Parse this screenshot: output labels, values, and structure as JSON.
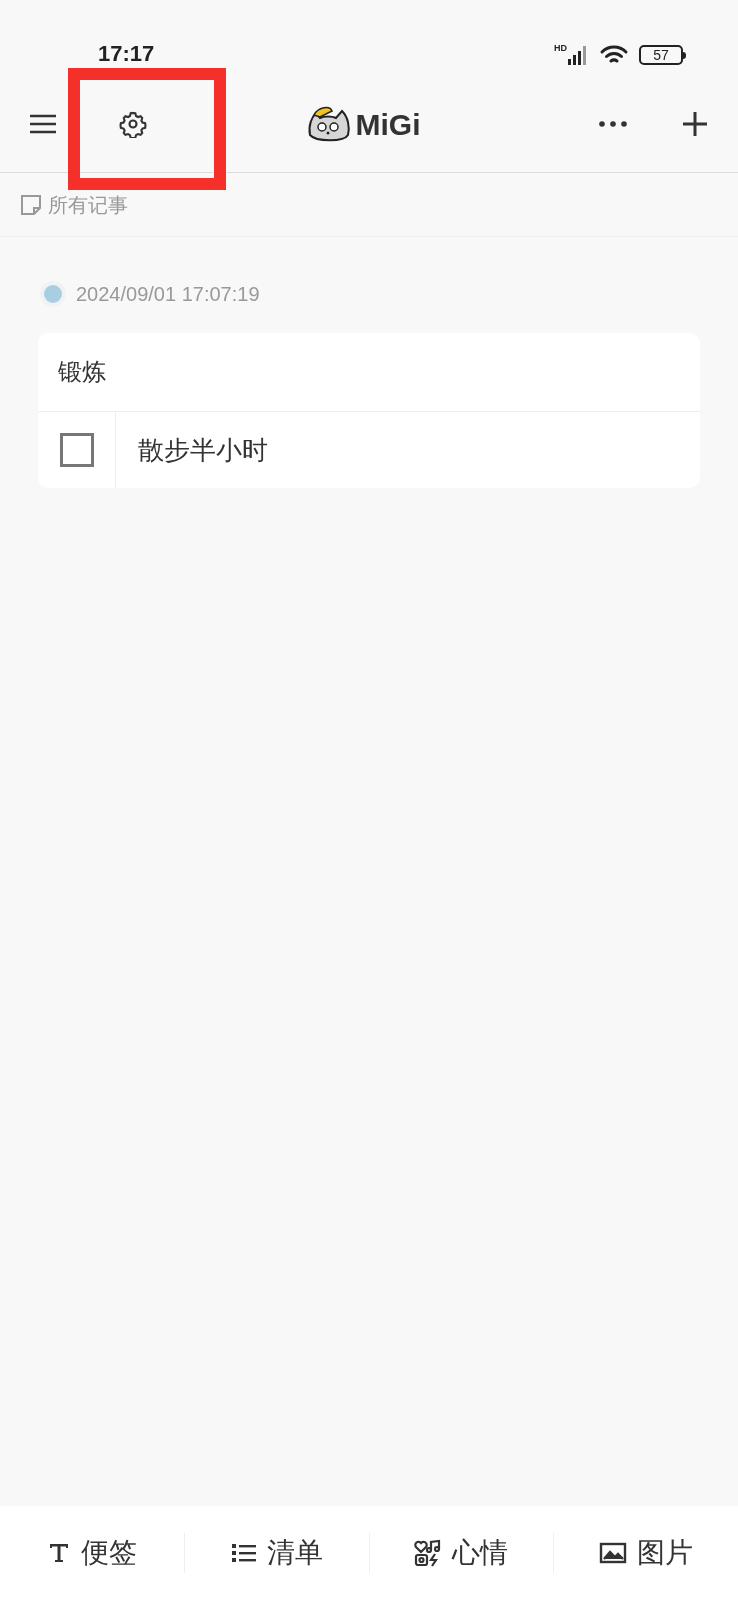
{
  "status_bar": {
    "time": "17:17",
    "network": "HD",
    "battery": "57"
  },
  "header": {
    "app_name": "MiGi"
  },
  "breadcrumb": {
    "label": "所有记事"
  },
  "entries": [
    {
      "date": "2024/09/01 17:07:19",
      "title": "锻炼",
      "items": [
        {
          "text": "散步半小时",
          "checked": false
        }
      ]
    }
  ],
  "bottom_tabs": [
    {
      "kind": "text",
      "label": "便签"
    },
    {
      "kind": "list",
      "label": "清单"
    },
    {
      "kind": "mood",
      "label": "心情"
    },
    {
      "kind": "image",
      "label": "图片"
    }
  ]
}
